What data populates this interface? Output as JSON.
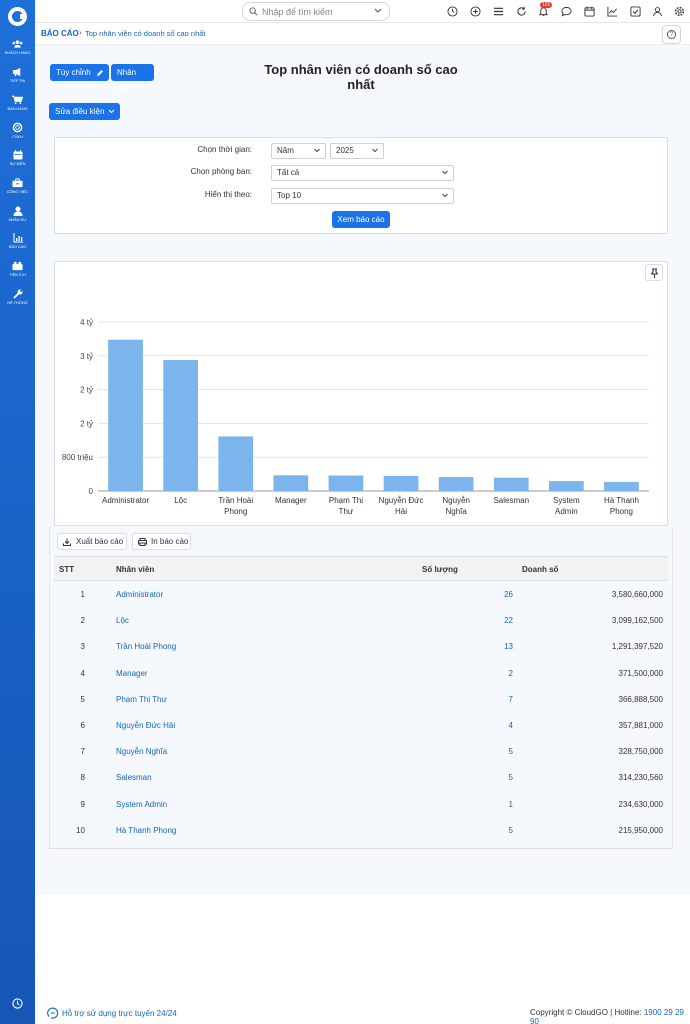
{
  "sidebar": {
    "items": [
      {
        "label": "KHÁCH HÀNG",
        "icon": "users-icon"
      },
      {
        "label": "TIẾP THỊ",
        "icon": "megaphone-icon"
      },
      {
        "label": "BÁN HÀNG",
        "icon": "cart-icon"
      },
      {
        "label": "CSKH",
        "icon": "support-icon"
      },
      {
        "label": "SỰ KIỆN",
        "icon": "calendar-icon"
      },
      {
        "label": "CÔNG VIỆC",
        "icon": "briefcase-icon"
      },
      {
        "label": "NHÂN SỰ",
        "icon": "person-icon"
      },
      {
        "label": "BÁO CÁO",
        "icon": "chart-icon"
      },
      {
        "label": "TIỆN ÍCH",
        "icon": "utilities-icon"
      },
      {
        "label": "HỆ THỐNG",
        "icon": "wrench-icon"
      }
    ]
  },
  "topbar": {
    "search_placeholder": "Nhập để tìm kiếm",
    "notification_count": "101"
  },
  "breadcrumb": {
    "root": "BÁO CÁO",
    "current": "Top nhân viên có doanh số cao nhất"
  },
  "toolbar": {
    "customize_label": "Tùy chỉnh",
    "duplicate_label": "Nhân đôi",
    "edit_condition_label": "Sửa điều kiện"
  },
  "page": {
    "title": "Top nhân viên có doanh số cao nhất"
  },
  "filters": {
    "time_label": "Chọn thời gian:",
    "period_value": "Năm",
    "year_value": "2025",
    "department_label": "Chọn phòng ban:",
    "department_value": "Tất cả",
    "display_label": "Hiển thị theo:",
    "display_value": "Top 10",
    "submit_label": "Xem báo cáo"
  },
  "chart_data": {
    "type": "bar",
    "categories": [
      "Administrator",
      "Lộc",
      "Trần Hoài Phong",
      "Manager",
      "Phạm Thị Thư",
      "Nguyễn Đức Hải",
      "Nguyễn Nghĩa",
      "Salesman",
      "System Admin",
      "Hà Thanh Phong"
    ],
    "values": [
      3580660000,
      3099162500,
      1291397520,
      371500000,
      366888500,
      357881000,
      328750000,
      314230560,
      234630000,
      215950000
    ],
    "y_tick_values": [
      0,
      800000000,
      1600000000,
      2400000000,
      3200000000,
      4000000000
    ],
    "y_tick_labels": [
      "0",
      "800 triệu",
      "2 tỷ",
      "2 tỷ",
      "3 tỷ",
      "4 tỷ"
    ],
    "ylim": [
      0,
      4000000000
    ],
    "bar_color": "#7cb5ec",
    "grid": true
  },
  "actions": {
    "export_label": "Xuất báo cáo",
    "print_label": "In báo cáo"
  },
  "table": {
    "headers": {
      "stt": "STT",
      "employee": "Nhân viên",
      "quantity": "Số lượng",
      "revenue": "Doanh số"
    },
    "rows": [
      {
        "stt": "1",
        "name": "Administrator",
        "qty": "26",
        "revenue": "3,580,660,000"
      },
      {
        "stt": "2",
        "name": "Lộc",
        "qty": "22",
        "revenue": "3,099,162,500"
      },
      {
        "stt": "3",
        "name": "Trần Hoài Phong",
        "qty": "13",
        "revenue": "1,291,397,520"
      },
      {
        "stt": "4",
        "name": "Manager",
        "qty": "2",
        "revenue": "371,500,000"
      },
      {
        "stt": "5",
        "name": "Phạm Thị Thư",
        "qty": "7",
        "revenue": "366,888,500"
      },
      {
        "stt": "6",
        "name": "Nguyễn Đức Hải",
        "qty": "4",
        "revenue": "357,881,000"
      },
      {
        "stt": "7",
        "name": "Nguyễn Nghĩa",
        "qty": "5",
        "revenue": "328,750,000"
      },
      {
        "stt": "8",
        "name": "Salesman",
        "qty": "5",
        "revenue": "314,230,560"
      },
      {
        "stt": "9",
        "name": "System Admin",
        "qty": "1",
        "revenue": "234,630,000"
      },
      {
        "stt": "10",
        "name": "Hà Thanh Phong",
        "qty": "5",
        "revenue": "215,950,000"
      }
    ]
  },
  "footer": {
    "support_text": "Hỗ trợ sử dụng trực tuyến 24/24",
    "copyright": "Copyright © CloudGO",
    "hotline_label": "Hotline:",
    "hotline_number": "1900 29 29 90"
  },
  "colors": {
    "primary": "#1a73e8",
    "sidebar": "#1e6fd9",
    "link": "#1565c0",
    "bar": "#7cb5ec"
  }
}
